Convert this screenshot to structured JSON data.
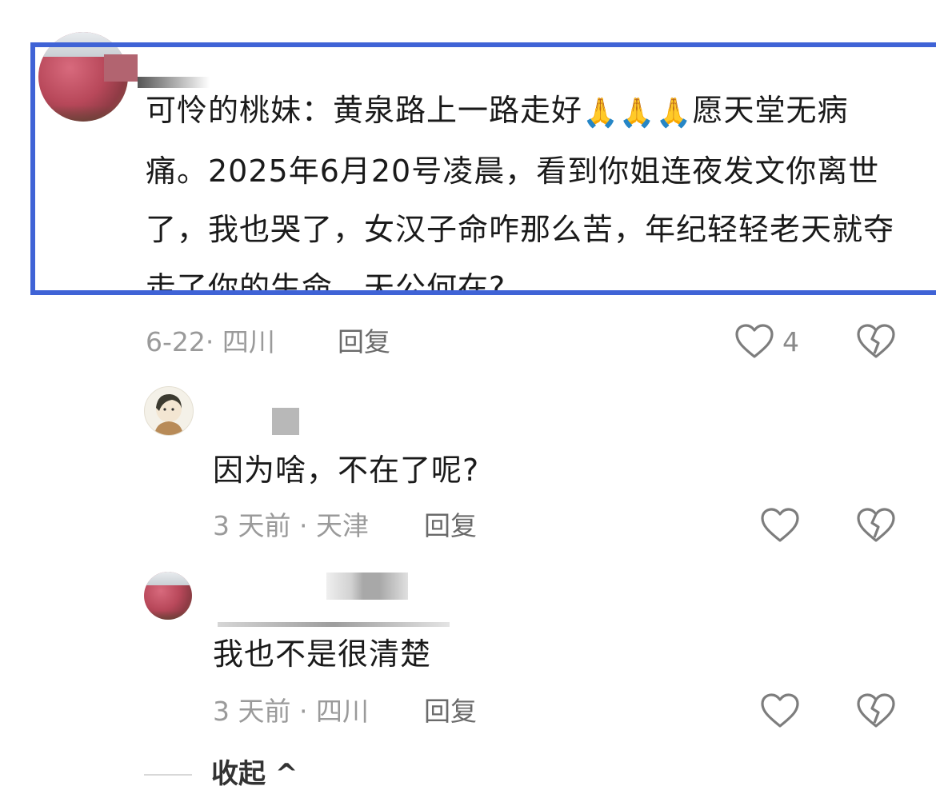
{
  "main_comment": {
    "author_prefix": "可怜的桃妹：",
    "text_part1": "黄泉路上一路走好",
    "emoji": "🙏🙏🙏",
    "text_part2": "愿天堂无病痛。2025年6月20号凌晨，看到你姐连夜发文你离世了，我也哭了，女汉子命咋那么苦，年纪轻轻老天就夺走了你的生命，天公何在?",
    "date_location": "6-22· 四川",
    "reply_label": "回复",
    "like_count": "4",
    "icons": [
      "heart-icon",
      "broken-heart-icon"
    ]
  },
  "replies": [
    {
      "text": "因为啥，不在了呢?",
      "date_location": "3 天前 · 天津",
      "reply_label": "回复",
      "icons": [
        "heart-icon",
        "broken-heart-icon"
      ]
    },
    {
      "text": "我也不是很清楚",
      "date_location": "3 天前 · 四川",
      "reply_label": "回复",
      "icons": [
        "heart-icon",
        "broken-heart-icon"
      ]
    }
  ],
  "collapse_label": "收起 ^",
  "colors": {
    "highlight_border": "#3f63d6",
    "text": "#1a1a1a",
    "meta": "#9a9a9a"
  }
}
